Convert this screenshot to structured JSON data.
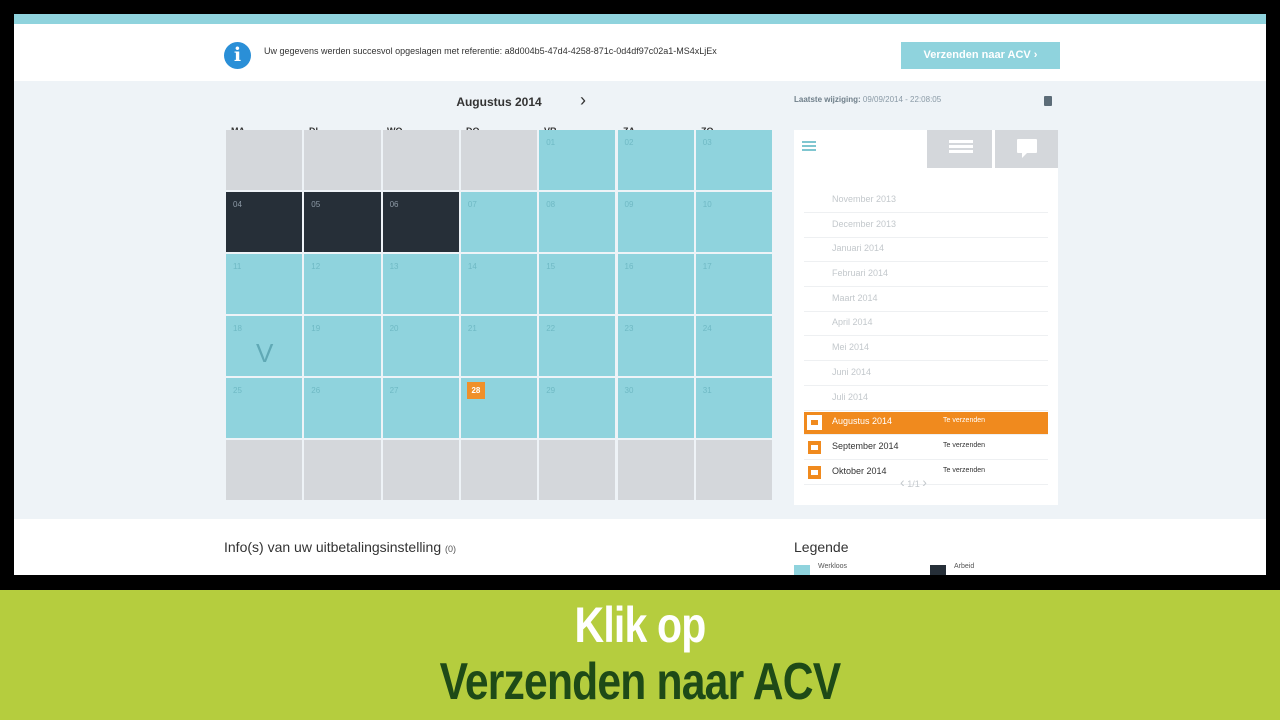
{
  "message": {
    "text": "Uw gegevens werden succesvol opgeslagen met referentie: a8d004b5-47d4-4258-871c-0d4df97c02a1-MS4xLjEx",
    "icon": "info-icon"
  },
  "toolbar": {
    "send_label": "Verzenden naar ACV ›"
  },
  "calendar": {
    "month_title": "Augustus 2014",
    "next_icon": "chevron-right-icon",
    "last_modified_label": "Laatste wijziging:",
    "last_modified_value": "09/09/2014 - 22:08:05",
    "weekdays": [
      "MA",
      "DI",
      "WO",
      "DO",
      "VR",
      "ZA",
      "ZO"
    ],
    "weeks": [
      [
        {
          "n": "",
          "s": "grey"
        },
        {
          "n": "",
          "s": "grey"
        },
        {
          "n": "",
          "s": "grey"
        },
        {
          "n": "",
          "s": "grey"
        },
        {
          "n": "01",
          "s": "cyan"
        },
        {
          "n": "02",
          "s": "cyan"
        },
        {
          "n": "03",
          "s": "cyan"
        }
      ],
      [
        {
          "n": "04",
          "s": "dark"
        },
        {
          "n": "05",
          "s": "dark"
        },
        {
          "n": "06",
          "s": "dark"
        },
        {
          "n": "07",
          "s": "cyan"
        },
        {
          "n": "08",
          "s": "cyan"
        },
        {
          "n": "09",
          "s": "cyan"
        },
        {
          "n": "10",
          "s": "cyan"
        }
      ],
      [
        {
          "n": "11",
          "s": "cyan"
        },
        {
          "n": "12",
          "s": "cyan"
        },
        {
          "n": "13",
          "s": "cyan"
        },
        {
          "n": "14",
          "s": "cyan"
        },
        {
          "n": "15",
          "s": "cyan"
        },
        {
          "n": "16",
          "s": "cyan"
        },
        {
          "n": "17",
          "s": "cyan"
        }
      ],
      [
        {
          "n": "18",
          "s": "cyan",
          "mark": "V"
        },
        {
          "n": "19",
          "s": "cyan"
        },
        {
          "n": "20",
          "s": "cyan"
        },
        {
          "n": "21",
          "s": "cyan"
        },
        {
          "n": "22",
          "s": "cyan"
        },
        {
          "n": "23",
          "s": "cyan"
        },
        {
          "n": "24",
          "s": "cyan"
        }
      ],
      [
        {
          "n": "25",
          "s": "cyan"
        },
        {
          "n": "26",
          "s": "cyan"
        },
        {
          "n": "27",
          "s": "cyan"
        },
        {
          "n": "28",
          "s": "cyan",
          "today": true
        },
        {
          "n": "29",
          "s": "cyan"
        },
        {
          "n": "30",
          "s": "cyan"
        },
        {
          "n": "31",
          "s": "cyan"
        }
      ],
      [
        {
          "n": "",
          "s": "grey"
        },
        {
          "n": "",
          "s": "grey"
        },
        {
          "n": "",
          "s": "grey"
        },
        {
          "n": "",
          "s": "grey"
        },
        {
          "n": "",
          "s": "grey"
        },
        {
          "n": "",
          "s": "grey"
        },
        {
          "n": "",
          "s": "grey"
        }
      ]
    ]
  },
  "sidepanel": {
    "tabs": [
      "menu-icon",
      "list-icon",
      "comment-icon"
    ],
    "months": [
      {
        "name": "November 2013",
        "status": "",
        "state": "done"
      },
      {
        "name": "December 2013",
        "status": "",
        "state": "done"
      },
      {
        "name": "Januari 2014",
        "status": "",
        "state": "done"
      },
      {
        "name": "Februari 2014",
        "status": "",
        "state": "done"
      },
      {
        "name": "Maart 2014",
        "status": "",
        "state": "done"
      },
      {
        "name": "April 2014",
        "status": "",
        "state": "done"
      },
      {
        "name": "Mei 2014",
        "status": "",
        "state": "done"
      },
      {
        "name": "Juni 2014",
        "status": "",
        "state": "done"
      },
      {
        "name": "Juli 2014",
        "status": "",
        "state": "done"
      },
      {
        "name": "Augustus 2014",
        "status": "Te verzenden",
        "state": "active"
      },
      {
        "name": "September 2014",
        "status": "Te verzenden",
        "state": "open"
      },
      {
        "name": "Oktober 2014",
        "status": "Te verzenden",
        "state": "open"
      }
    ],
    "pager": "1/1"
  },
  "info": {
    "heading": "Info(s) van uw uitbetalingsinstelling",
    "count": "(0)"
  },
  "legend": {
    "title": "Legende",
    "items": [
      {
        "label": "Werkloos",
        "color": "#8fd3dd"
      },
      {
        "label": "Arbeid",
        "color": "#262f38"
      }
    ]
  },
  "banner": {
    "line1": "Klik op",
    "line2": "Verzenden naar ACV"
  },
  "colors": {
    "cyan": "#8fd3dd",
    "dark": "#262f38",
    "orange": "#f08a1e",
    "banner_green": "#b5cd3e",
    "banner_text": "#1e4a17"
  }
}
